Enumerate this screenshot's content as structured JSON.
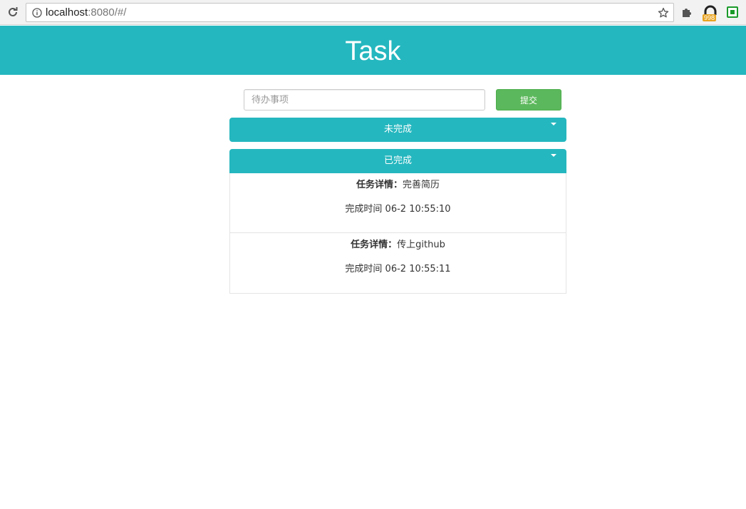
{
  "browser": {
    "url_host": "localhost",
    "url_rest": ":8080/#/",
    "extension_badge": "998"
  },
  "app": {
    "title": "Task"
  },
  "form": {
    "placeholder": "待办事项",
    "submit_label": "提交"
  },
  "panels": {
    "todo_label": "未完成",
    "done_label": "已完成"
  },
  "done_items": [
    {
      "detail_label": "任务详情：",
      "detail_value": "完善简历",
      "time_text": "完成时间 06-2 10:55:10"
    },
    {
      "detail_label": "任务详情：",
      "detail_value": "传上github",
      "time_text": "完成时间 06-2 10:55:11"
    }
  ],
  "colors": {
    "accent": "#25b7bf",
    "submit": "#5cb85c"
  }
}
